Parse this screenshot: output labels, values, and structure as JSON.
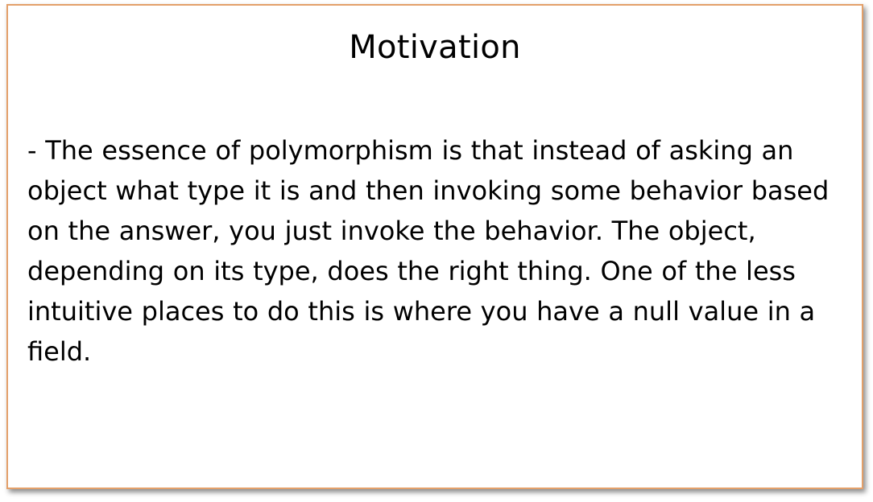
{
  "slide": {
    "title": "Motivation",
    "body": "- The essence of polymorphism is that instead of asking an object what type it is and then invoking some behavior based on the answer, you just invoke the behavior. The object, depending on its type, does the right thing. One of the less intuitive places to do this is where you have a null value in a field."
  },
  "colors": {
    "border": "#e3a06a",
    "text": "#000000",
    "background": "#ffffff"
  }
}
